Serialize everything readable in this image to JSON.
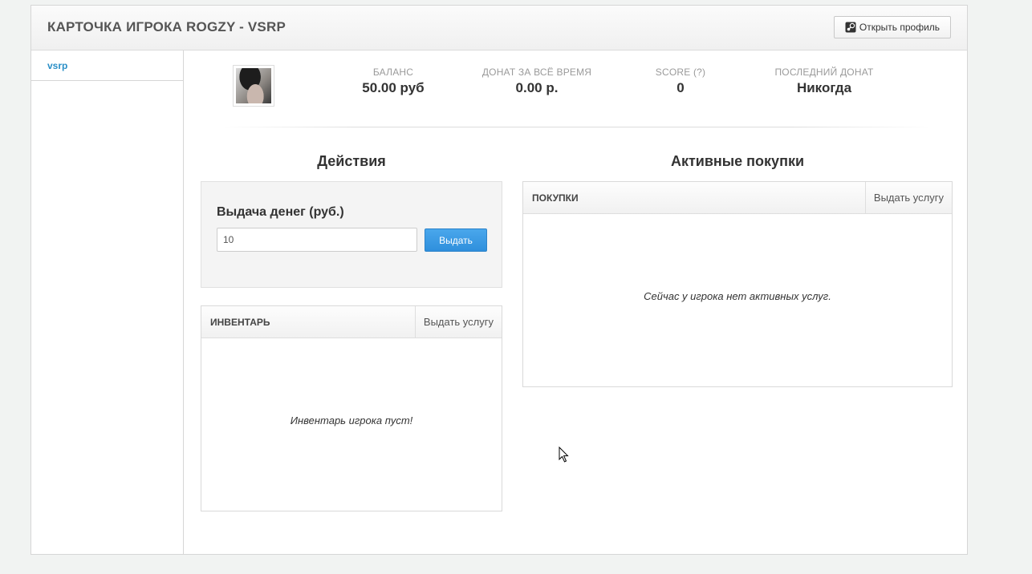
{
  "header": {
    "title": "КАРТОЧКА ИГРОКА ROGZY - VSRP",
    "open_profile_label": "Открыть профиль",
    "open_profile_icon": "steam-icon"
  },
  "sidebar": {
    "items": [
      {
        "label": "vsrp"
      }
    ]
  },
  "stats": [
    {
      "label": "БАЛАНС",
      "value": "50.00 руб"
    },
    {
      "label": "ДОНАТ ЗА ВСЁ ВРЕМЯ",
      "value": "0.00 р."
    },
    {
      "label": "SCORE (?)",
      "value": "0"
    },
    {
      "label": "ПОСЛЕДНИЙ ДОНАТ",
      "value": "Никогда"
    }
  ],
  "actions": {
    "title": "Действия",
    "money": {
      "title": "Выдача денег (руб.)",
      "input_value": "10",
      "button_label": "Выдать"
    },
    "inventory": {
      "title": "ИНВЕНТАРЬ",
      "action_label": "Выдать услугу",
      "empty_text": "Инвентарь игрока пуст!"
    }
  },
  "purchases": {
    "title": "Активные покупки",
    "table_title": "ПОКУПКИ",
    "action_label": "Выдать услугу",
    "empty_text": "Сейчас у игрока нет активных услуг."
  },
  "colors": {
    "accent": "#2a8fc7",
    "button": "#3597e2"
  }
}
